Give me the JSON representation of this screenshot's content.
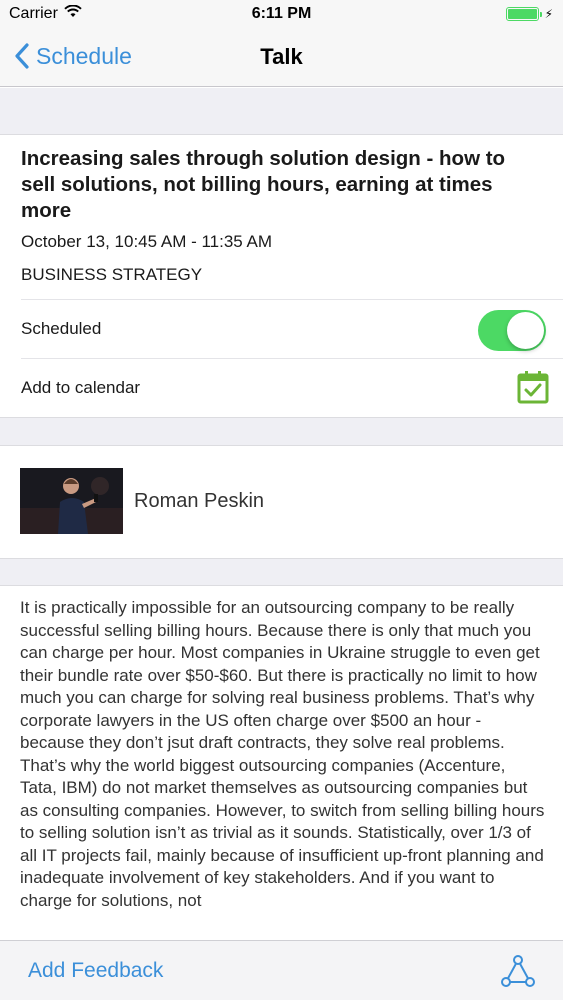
{
  "status_bar": {
    "carrier": "Carrier",
    "time": "6:11 PM"
  },
  "nav": {
    "back_label": "Schedule",
    "title": "Talk"
  },
  "talk": {
    "title": "Increasing sales through solution design - how to sell solutions, not billing hours, earning at times more",
    "time": "October 13, 10:45 AM - 11:35 AM",
    "track": "BUSINESS STRATEGY",
    "scheduled_label": "Scheduled",
    "scheduled": true,
    "calendar_label": "Add to calendar"
  },
  "speaker": {
    "name": "Roman  Peskin"
  },
  "description": "It is practically impossible for an outsourcing company to be really successful selling billing hours. Because there is only that much you can charge per hour. Most companies in Ukraine struggle to even get their bundle rate over $50-$60. But there is practically no limit to how much you can charge for solving real business problems. That’s why corporate lawyers in the US often charge over $500 an hour - because they don’t jsut draft contracts, they solve real problems. That’s why the world biggest outsourcing companies (Accenture, Tata, IBM) do not market themselves as outsourcing companies but as consulting companies. However, to switch from selling billing hours to selling solution isn’t as trivial as it sounds. Statistically, over 1/3 of all IT projects fail, mainly because of insufficient up-front planning and inadequate involvement of key stakeholders. And if you want to charge for solutions, not",
  "tab_bar": {
    "feedback_label": "Add Feedback"
  },
  "colors": {
    "accent": "#3b8fd9",
    "toggle_on": "#4cd964",
    "calendar": "#6bb536",
    "background_gap": "#efeff4"
  },
  "icons": [
    "wifi-icon",
    "battery-icon",
    "chevron-left-icon",
    "calendar-check-icon",
    "graph-network-icon"
  ]
}
